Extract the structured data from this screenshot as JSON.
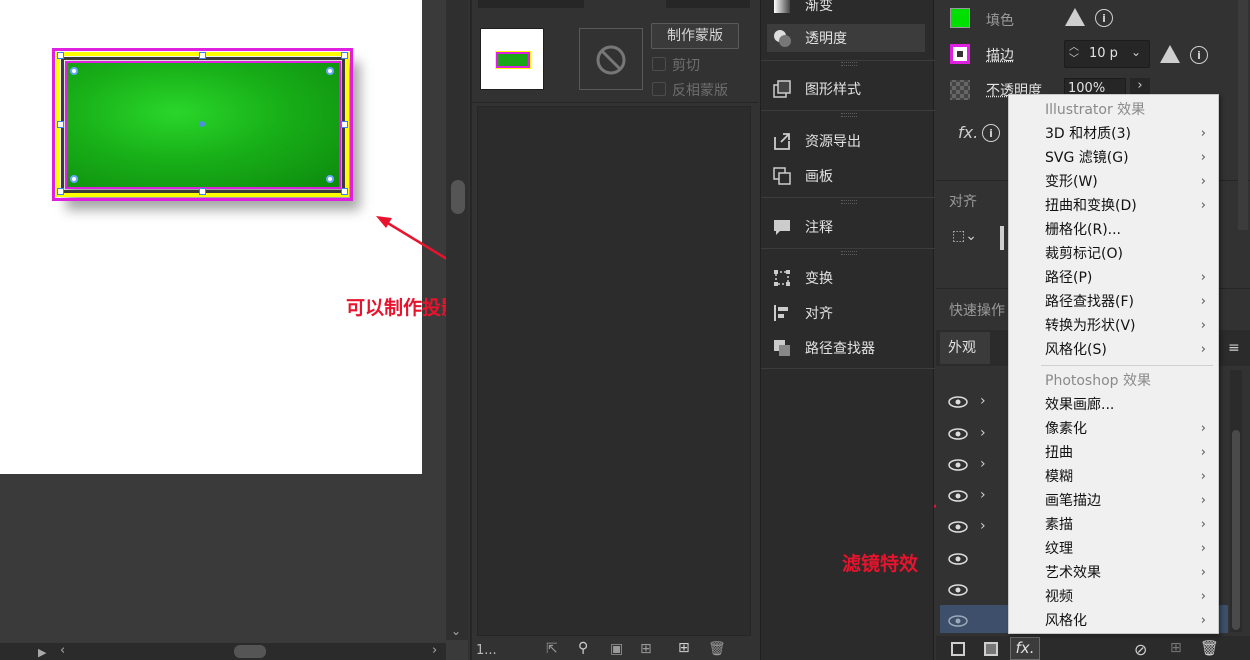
{
  "transparency_panel": {
    "make_mask_label": "制作蒙版",
    "clip_label": "剪切",
    "invert_mask_label": "反相蒙版",
    "layers_count": "1..."
  },
  "tool_list": [
    {
      "label": "渐变",
      "icon": "gradient-icon"
    },
    {
      "label": "透明度",
      "icon": "transparency-icon"
    },
    {
      "label": "图形样式",
      "icon": "graphic-styles-icon"
    },
    {
      "label": "资源导出",
      "icon": "asset-export-icon"
    },
    {
      "label": "画板",
      "icon": "artboards-icon"
    },
    {
      "label": "注释",
      "icon": "comments-icon"
    },
    {
      "label": "变换",
      "icon": "transform-icon"
    },
    {
      "label": "对齐",
      "icon": "align-icon"
    },
    {
      "label": "路径查找器",
      "icon": "pathfinder-icon"
    }
  ],
  "properties": {
    "fill_label": "填色",
    "stroke_label": "描边",
    "stroke_weight": "10 p",
    "opacity_label": "不透明度",
    "opacity_value": "100%",
    "align_section": "对齐",
    "quick_actions_section": "快速操作",
    "fill_color": "#00e000",
    "stroke_color": "#e020e0"
  },
  "appearance": {
    "tab_label": "外观"
  },
  "fx_menu": {
    "illustrator_header": "Illustrator 效果",
    "illustrator_items": [
      {
        "label": "3D 和材质(3)",
        "submenu": true
      },
      {
        "label": "SVG 滤镜(G)",
        "submenu": true
      },
      {
        "label": "变形(W)",
        "submenu": true
      },
      {
        "label": "扭曲和变换(D)",
        "submenu": true
      },
      {
        "label": "栅格化(R)...",
        "submenu": false
      },
      {
        "label": "裁剪标记(O)",
        "submenu": false
      },
      {
        "label": "路径(P)",
        "submenu": true
      },
      {
        "label": "路径查找器(F)",
        "submenu": true
      },
      {
        "label": "转换为形状(V)",
        "submenu": true
      },
      {
        "label": "风格化(S)",
        "submenu": true
      }
    ],
    "photoshop_header": "Photoshop 效果",
    "photoshop_items": [
      {
        "label": "效果画廊...",
        "submenu": false
      },
      {
        "label": "像素化",
        "submenu": true
      },
      {
        "label": "扭曲",
        "submenu": true
      },
      {
        "label": "模糊",
        "submenu": true
      },
      {
        "label": "画笔描边",
        "submenu": true
      },
      {
        "label": "素描",
        "submenu": true
      },
      {
        "label": "纹理",
        "submenu": true
      },
      {
        "label": "艺术效果",
        "submenu": true
      },
      {
        "label": "视频",
        "submenu": true
      },
      {
        "label": "风格化",
        "submenu": true
      }
    ]
  },
  "annotations": {
    "shadow_note": "可以制作投影，木雕等各种特效",
    "filter_note": "滤镜特效"
  },
  "fx_button_label": "fx.",
  "colors": {
    "annotation_red": "#e8132c",
    "shape_green": "#1aa81a",
    "selection_magenta": "#e020e0",
    "selection_yellow": "#ffff00"
  }
}
